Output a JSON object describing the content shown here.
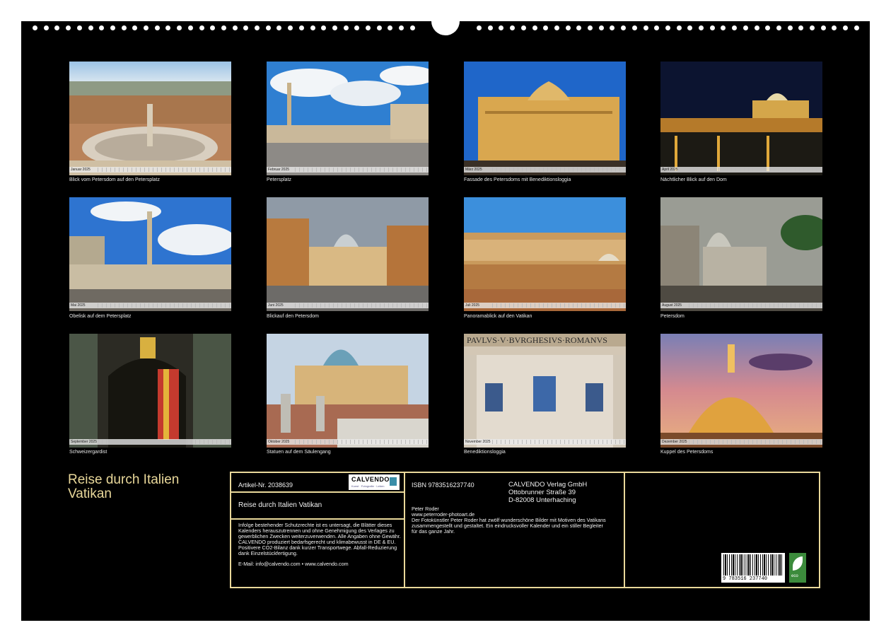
{
  "title": {
    "line1": "Reise durch Italien",
    "line2": "Vatikan"
  },
  "photos": [
    {
      "caption": "Blick vom Petersdom auf den Petersplatz",
      "month": "Januar 2025"
    },
    {
      "caption": "Petersplatz",
      "month": "Februar 2025"
    },
    {
      "caption": "Fassade des Petersdoms mit Benediktionsloggia",
      "month": "März 2025"
    },
    {
      "caption": "Nächtlicher Blick auf den Dom",
      "month": "April 2025"
    },
    {
      "caption": "Obelisk auf dem Petersplatz",
      "month": "Mai 2025"
    },
    {
      "caption": "Blickauf den Petersdom",
      "month": "Juni 2025"
    },
    {
      "caption": "Panoramablick auf den Vatikan",
      "month": "Juli 2025"
    },
    {
      "caption": "Petersdom",
      "month": "August 2025"
    },
    {
      "caption": "Schweizergardist",
      "month": "September 2025"
    },
    {
      "caption": "Statuen auf dem Säulengang",
      "month": "Oktober 2025"
    },
    {
      "caption": "Benediktionsloggia",
      "month": "November 2025"
    },
    {
      "caption": "Kuppel des Petersdoms",
      "month": "Dezember 2025"
    }
  ],
  "info": {
    "article": "Artikel-Nr. 2038639",
    "logo": "CALVENDO",
    "logo_sub": "Kunst · Fotografie · Leben",
    "product_title": "Reise durch Italien Vatikan",
    "legal": "Infolge bestehender Schutzrechte ist es untersagt, die Blätter dieses Kalenders herauszutrennen und ohne Genehmigung des Verlages zu gewerblichen Zwecken weiterzuverwenden. Alle Angaben ohne Gewähr. CALVENDO produziert bedarfsgerecht und klimabewusst in DE & EU. Positivere CO2-Bilanz dank kurzer Transportwege. Abfall-Reduzierung dank Einzelstückfertigung.",
    "email": "E-Mail: info@calvendo.com • www.calvendo.com",
    "isbn": "ISBN 9783516237740",
    "publisher": [
      "CALVENDO Verlag GmbH",
      "Ottobrunner Straße 39",
      "D-82008 Unterhaching"
    ],
    "author": "Peter Roder",
    "website": "www.peterroder-photoart.de",
    "description": "Der Fotokünstler Peter Roder hat zwölf wunderschöne Bilder mit Motiven des Vatikans zusammengestellt und gestaltet. Ein eindrucksvoller Kalender und ein stiller Begleiter für das ganze Jahr.",
    "barcode_number": "9 783516 237740",
    "eco_label": "eco"
  },
  "colors": {
    "background": "#000000",
    "accent": "#e9d89a",
    "text": "#f2f2f2"
  }
}
